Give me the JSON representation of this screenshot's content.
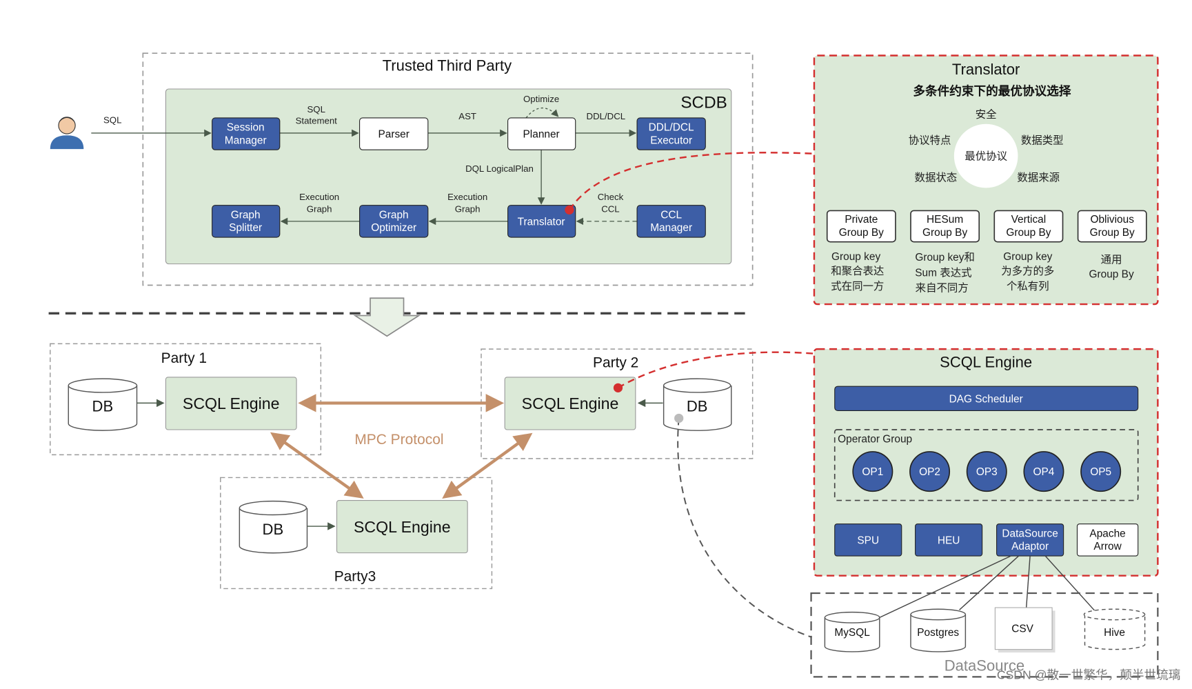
{
  "colors": {
    "box_blue": "#3d5ea6",
    "panel_green": "#dbe9d7",
    "highlight_red": "#d42f2f",
    "mpc_brown": "#c4906a"
  },
  "trusted": {
    "title": "Trusted Third Party",
    "scdb_label": "SCDB",
    "sql_label": "SQL",
    "boxes": {
      "session": [
        "Session",
        "Manager"
      ],
      "parser": "Parser",
      "planner": "Planner",
      "ddl": [
        "DDL/DCL",
        "Executor"
      ],
      "splitter": [
        "Graph",
        "Splitter"
      ],
      "optimizer": [
        "Graph",
        "Optimizer"
      ],
      "translator": "Translator",
      "ccl": [
        "CCL",
        "Manager"
      ]
    },
    "edges": {
      "sql_statement": [
        "SQL",
        "Statement"
      ],
      "ast": "AST",
      "optimize": "Optimize",
      "ddl_dcl": "DDL/DCL",
      "dql": "DQL LogicalPlan",
      "exec1": [
        "Execution",
        "Graph"
      ],
      "exec2": [
        "Execution",
        "Graph"
      ],
      "check_ccl": [
        "Check",
        "CCL"
      ]
    }
  },
  "translator_panel": {
    "title": "Translator",
    "subtitle": "多条件约束下的最优协议选择",
    "center": "最优协议",
    "factors": [
      "安全",
      "协议特点",
      "数据类型",
      "数据状态",
      "数据来源"
    ],
    "strategies": [
      {
        "name": [
          "Private",
          "Group By"
        ],
        "desc": [
          "Group key",
          "和聚合表达",
          "式在同一方"
        ]
      },
      {
        "name": [
          "HESum",
          "Group By"
        ],
        "desc": [
          "Group key和",
          "Sum 表达式",
          "来自不同方"
        ]
      },
      {
        "name": [
          "Vertical",
          "Group By"
        ],
        "desc": [
          "Group key",
          "为多方的多",
          "个私有列"
        ]
      },
      {
        "name": [
          "Oblivious",
          "Group By"
        ],
        "desc": [
          "通用",
          "Group By"
        ]
      }
    ]
  },
  "parties": {
    "p1": {
      "title": "Party 1",
      "db": "DB",
      "engine": "SCQL Engine"
    },
    "p2": {
      "title": "Party 2",
      "db": "DB",
      "engine": "SCQL Engine"
    },
    "p3": {
      "title": "Party3",
      "db": "DB",
      "engine": "SCQL Engine"
    },
    "mpc": "MPC Protocol"
  },
  "engine_panel": {
    "title": "SCQL Engine",
    "dag": "DAG Scheduler",
    "op_group": "Operator Group",
    "ops": [
      "OP1",
      "OP2",
      "OP3",
      "OP4",
      "OP5"
    ],
    "modules": {
      "spu": "SPU",
      "heu": "HEU",
      "dsa": [
        "DataSource",
        "Adaptor"
      ],
      "arrow": [
        "Apache",
        "Arrow"
      ]
    }
  },
  "datasource": {
    "title": "DataSource",
    "items": [
      "MySQL",
      "Postgres",
      "CSV",
      "Hive"
    ]
  },
  "watermark": "CSDN @散一世繁华，颠半世琉璃"
}
